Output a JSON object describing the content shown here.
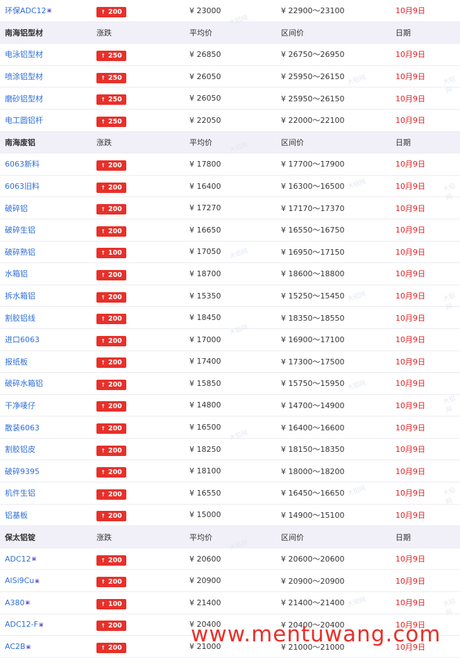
{
  "colors": {
    "accent_red": "#e8302a",
    "link_blue": "#2f6fd6",
    "header_bg": "#f1f0f8"
  },
  "icons": {
    "up": "up-arrow-icon",
    "tag": "tag-icon"
  },
  "rows": [
    {
      "type": "item",
      "name": "环保ADC12",
      "tag": true,
      "change": "200",
      "avg": "¥  23000",
      "range": "¥  22900～23100",
      "date": "10月9日"
    },
    {
      "type": "header",
      "name": "南海铝型材",
      "change": "涨跌",
      "avg": "平均价",
      "range": "区间价",
      "date": "日期"
    },
    {
      "type": "item",
      "name": "电泳铝型材",
      "change": "250",
      "avg": "¥  26850",
      "range": "¥  26750～26950",
      "date": "10月9日"
    },
    {
      "type": "item",
      "name": "喷涂铝型材",
      "change": "250",
      "avg": "¥  26050",
      "range": "¥  25950～26150",
      "date": "10月9日"
    },
    {
      "type": "item",
      "name": "磨砂铝型材",
      "change": "250",
      "avg": "¥  26050",
      "range": "¥  25950～26150",
      "date": "10月9日"
    },
    {
      "type": "item",
      "name": "电工圆铝杆",
      "change": "250",
      "avg": "¥  22050",
      "range": "¥  22000～22100",
      "date": "10月9日"
    },
    {
      "type": "header",
      "name": "南海废铝",
      "change": "涨跌",
      "avg": "平均价",
      "range": "区间价",
      "date": "日期"
    },
    {
      "type": "item",
      "name": "6063新料",
      "change": "200",
      "avg": "¥  17800",
      "range": "¥  17700～17900",
      "date": "10月9日"
    },
    {
      "type": "item",
      "name": "6063旧料",
      "change": "200",
      "avg": "¥  16400",
      "range": "¥  16300～16500",
      "date": "10月9日"
    },
    {
      "type": "item",
      "name": "破碎铝",
      "change": "200",
      "avg": "¥  17270",
      "range": "¥  17170～17370",
      "date": "10月9日"
    },
    {
      "type": "item",
      "name": "破碎生铝",
      "change": "200",
      "avg": "¥  16650",
      "range": "¥  16550～16750",
      "date": "10月9日"
    },
    {
      "type": "item",
      "name": "破碎熟铝",
      "change": "100",
      "avg": "¥  17050",
      "range": "¥  16950～17150",
      "date": "10月9日"
    },
    {
      "type": "item",
      "name": "水箱铝",
      "change": "200",
      "avg": "¥  18700",
      "range": "¥  18600～18800",
      "date": "10月9日"
    },
    {
      "type": "item",
      "name": "拆水箱铝",
      "change": "200",
      "avg": "¥  15350",
      "range": "¥  15250～15450",
      "date": "10月9日"
    },
    {
      "type": "item",
      "name": "割胶铝线",
      "change": "200",
      "avg": "¥  18450",
      "range": "¥  18350～18550",
      "date": "10月9日"
    },
    {
      "type": "item",
      "name": "进口6063",
      "change": "200",
      "avg": "¥  17000",
      "range": "¥  16900～17100",
      "date": "10月9日"
    },
    {
      "type": "item",
      "name": "报纸板",
      "change": "200",
      "avg": "¥  17400",
      "range": "¥  17300～17500",
      "date": "10月9日"
    },
    {
      "type": "item",
      "name": "破碎水箱铝",
      "change": "200",
      "avg": "¥  15850",
      "range": "¥  15750～15950",
      "date": "10月9日"
    },
    {
      "type": "item",
      "name": "干净唛仔",
      "change": "200",
      "avg": "¥  14800",
      "range": "¥  14700～14900",
      "date": "10月9日"
    },
    {
      "type": "item",
      "name": "散装6063",
      "change": "200",
      "avg": "¥  16500",
      "range": "¥  16400～16600",
      "date": "10月9日"
    },
    {
      "type": "item",
      "name": "割胶铝皮",
      "change": "200",
      "avg": "¥  18250",
      "range": "¥  18150～18350",
      "date": "10月9日"
    },
    {
      "type": "item",
      "name": "破碎9395",
      "change": "200",
      "avg": "¥  18100",
      "range": "¥  18000～18200",
      "date": "10月9日"
    },
    {
      "type": "item",
      "name": "机件生铝",
      "change": "200",
      "avg": "¥  16550",
      "range": "¥  16450～16650",
      "date": "10月9日"
    },
    {
      "type": "item",
      "name": "铝基板",
      "change": "200",
      "avg": "¥  15000",
      "range": "¥  14900～15100",
      "date": "10月9日"
    },
    {
      "type": "header",
      "name": "保太铝锭",
      "change": "涨跌",
      "avg": "平均价",
      "range": "区间价",
      "date": "日期"
    },
    {
      "type": "item",
      "name": "ADC12",
      "tag": true,
      "change": "200",
      "avg": "¥  20600",
      "range": "¥  20600～20600",
      "date": "10月9日"
    },
    {
      "type": "item",
      "name": "AlSi9Cu",
      "tag": true,
      "change": "200",
      "avg": "¥  20900",
      "range": "¥  20900～20900",
      "date": "10月9日"
    },
    {
      "type": "item",
      "name": "A380",
      "tag": true,
      "change": "100",
      "avg": "¥  21400",
      "range": "¥  21400～21400",
      "date": "10月9日"
    },
    {
      "type": "item",
      "name": "ADC12-F",
      "tag": true,
      "change": "200",
      "avg": "¥  20400",
      "range": "¥  20400～20400",
      "date": "10月9日"
    },
    {
      "type": "item",
      "name": "AC2B",
      "tag": true,
      "change": "200",
      "avg": "¥  21000",
      "range": "¥  21000～21000",
      "date": "10月9日"
    }
  ],
  "watermark": {
    "site": "www.mentuwang.com",
    "mark": "大铝网"
  }
}
